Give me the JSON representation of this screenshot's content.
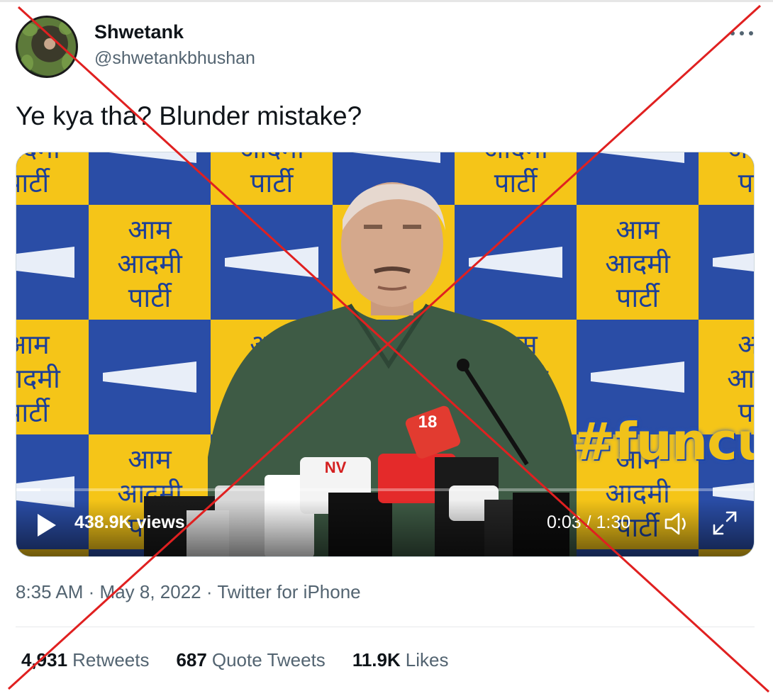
{
  "author": {
    "name": "Shwetank",
    "handle": "@shwetankbhushan"
  },
  "more_icon": "more-horizontal-icon",
  "tweet": {
    "text": "Ye kya tha? Blunder mistake?"
  },
  "video": {
    "backdrop_text": [
      "आम",
      "आदमी",
      "पार्टी"
    ],
    "watermark": "#funcut",
    "mic_logos": [
      "18",
      "NV"
    ],
    "views": "438.9K views",
    "time": "0:03 / 1:30",
    "progress": 0.033,
    "icons": [
      "play-icon",
      "volume-icon",
      "fullscreen-icon"
    ]
  },
  "meta": {
    "time": "8:35 AM",
    "date": "May 8, 2022",
    "separator": "·",
    "source": "Twitter for iPhone"
  },
  "stats": {
    "retweets": {
      "count": "4,931",
      "label": "Retweets"
    },
    "quote_tweets": {
      "count": "687",
      "label": "Quote Tweets"
    },
    "likes": {
      "count": "11.9K",
      "label": "Likes"
    }
  },
  "colors": {
    "overlay_cross": "#e02020",
    "party_yellow": "#f5c518",
    "party_blue": "#2a4da6",
    "muted_text": "#536471"
  }
}
